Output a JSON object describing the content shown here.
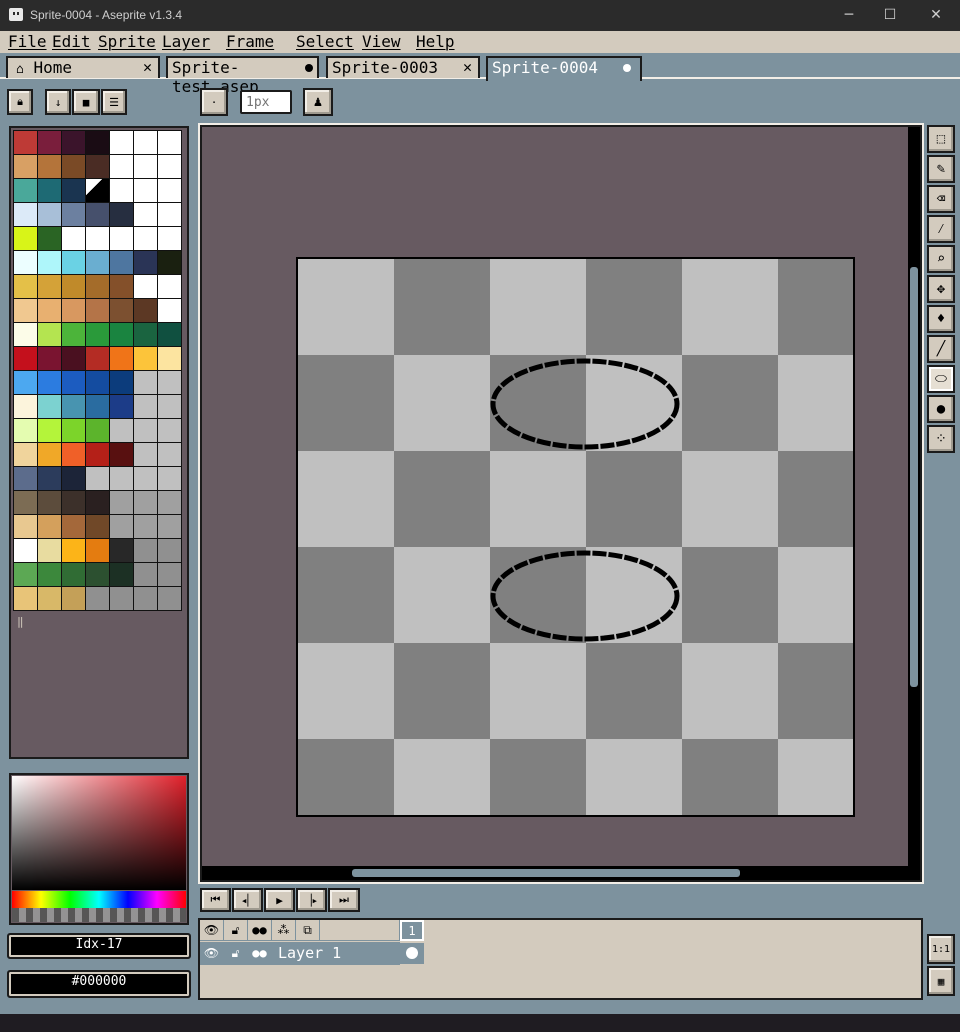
{
  "window": {
    "title": "Sprite-0004 - Aseprite v1.3.4",
    "minimize": "─",
    "maximize": "☐",
    "close": "✕"
  },
  "menu": [
    "File",
    "Edit",
    "Sprite",
    "Layer",
    "Frame",
    "Select",
    "View",
    "Help"
  ],
  "tabs": [
    {
      "label": "Home",
      "icon": "home-icon",
      "state": "close"
    },
    {
      "label": "Sprite-test.asep",
      "state": "modified"
    },
    {
      "label": "Sprite-0003",
      "state": "close"
    },
    {
      "label": "Sprite-0004",
      "state": "modified",
      "active": true
    }
  ],
  "toolbar": {
    "brush_size_placeholder": "1px"
  },
  "palette": {
    "colors": [
      "#be3a36",
      "#7a1e3c",
      "#3b142b",
      "#1a0c14",
      "#ffffff",
      "#ffffff",
      "#ffffff",
      "#d8a064",
      "#b4743a",
      "#7a4a26",
      "#4a2c24",
      "#ffffff",
      "#ffffff",
      "#ffffff",
      "#4aa89a",
      "#1e6a74",
      "#1a3450",
      "#000000",
      "#ffffff",
      "#ffffff",
      "#ffffff",
      "#dceaf8",
      "#a8bfd8",
      "#6c80a0",
      "#46506c",
      "#262e40",
      "#ffffff",
      "#ffffff",
      "#d8f418",
      "#2a6424",
      "#ffffff",
      "#ffffff",
      "#ffffff",
      "#ffffff",
      "#ffffff",
      "#ecfeff",
      "#aef6fa",
      "#6ad2e4",
      "#6aaed0",
      "#4e76a0",
      "#2a3456",
      "#1a2010",
      "#e4c048",
      "#d4a238",
      "#c08a2a",
      "#a46c2a",
      "#84502a",
      "#ffffff",
      "#ffffff",
      "#f0c890",
      "#e8b070",
      "#d89860",
      "#b47448",
      "#7c5030",
      "#5c3824",
      "#ffffff",
      "#fcfce8",
      "#b4e450",
      "#4cb43a",
      "#2a9a3a",
      "#1a8440",
      "#1a6440",
      "#105040",
      "#c4101c",
      "#7a1430",
      "#4a1020",
      "#b42c24",
      "#f07418",
      "#fcc43a",
      "#fce4a0",
      "#4ca8f0",
      "#2c7ce0",
      "#1c5cc0",
      "#144ca0",
      "#0c3c7c",
      "#c0c0c0",
      "#c0c0c0",
      "#fcf4dc",
      "#7cd2d0",
      "#4894b0",
      "#2a6ca0",
      "#1c3c88",
      "#c0c0c0",
      "#c0c0c0",
      "#e4fcb0",
      "#b4f43a",
      "#7cd42a",
      "#5cb42c",
      "#c0c0c0",
      "#c0c0c0",
      "#c0c0c0",
      "#f0d49c",
      "#f0a828",
      "#f06028",
      "#b42018",
      "#581010",
      "#c0c0c0",
      "#c0c0c0",
      "#5c6c8c",
      "#2c3c5c",
      "#1c2438",
      "#c0c0c0",
      "#c0c0c0",
      "#c0c0c0",
      "#c0c0c0",
      "#7c6c54",
      "#5c4c3c",
      "#3c302a",
      "#2a2020",
      "#a0a0a0",
      "#a0a0a0",
      "#a0a0a0",
      "#e8c890",
      "#d4a05c",
      "#a4683a",
      "#704828",
      "#a0a0a0",
      "#a0a0a0",
      "#a0a0a0",
      "#ffffff",
      "#e8dca0",
      "#fcb418",
      "#e47c10",
      "#282828",
      "#909090",
      "#909090",
      "#5ca854",
      "#3c883c",
      "#306c34",
      "#2c5030",
      "#1c3024",
      "#909090",
      "#909090",
      "#e8c478",
      "#d8b868",
      "#c4a058",
      "#909090",
      "#909090",
      "#909090",
      "#909090"
    ],
    "selected_index": 17
  },
  "color_fields": {
    "index": "Idx-17",
    "hex": "#000000"
  },
  "timeline": {
    "frame_number": "1",
    "layer_name": "Layer 1"
  },
  "accent": "#7d929e"
}
